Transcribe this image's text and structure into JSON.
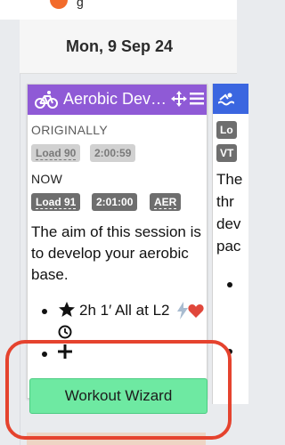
{
  "top": {
    "text_fragment": "g"
  },
  "day": {
    "date": "Mon, 9 Sep 24"
  },
  "card": {
    "title": "Aerobic Dev…",
    "originally_label": "ORIGINALLY",
    "originally_load": "Load 90",
    "originally_duration": "2:00:59",
    "now_label": "NOW",
    "now_load": "Load 91",
    "now_duration": "2:01:00",
    "now_type": "AER",
    "description": "The aim of this session is to develop your aerobic base.",
    "step_text": "2h 1′ All at L2",
    "wizard_button": "Workout Wizard"
  },
  "colors": {
    "header_purple": "#8f5ad6",
    "button_green": "#6ee9a2",
    "highlight_red": "#e5432e",
    "swim_blue": "#3b66e0"
  },
  "icons": [
    "bike-icon",
    "move-icon",
    "menu-icon",
    "star-icon",
    "bolt-icon",
    "heart-icon",
    "clock-icon",
    "plus-icon",
    "swim-icon"
  ],
  "card2": {
    "badge_a": "Lo",
    "badge_b": "VT",
    "frag1": "The",
    "frag2": "thr",
    "frag3": "dev",
    "frag4": "pac"
  }
}
